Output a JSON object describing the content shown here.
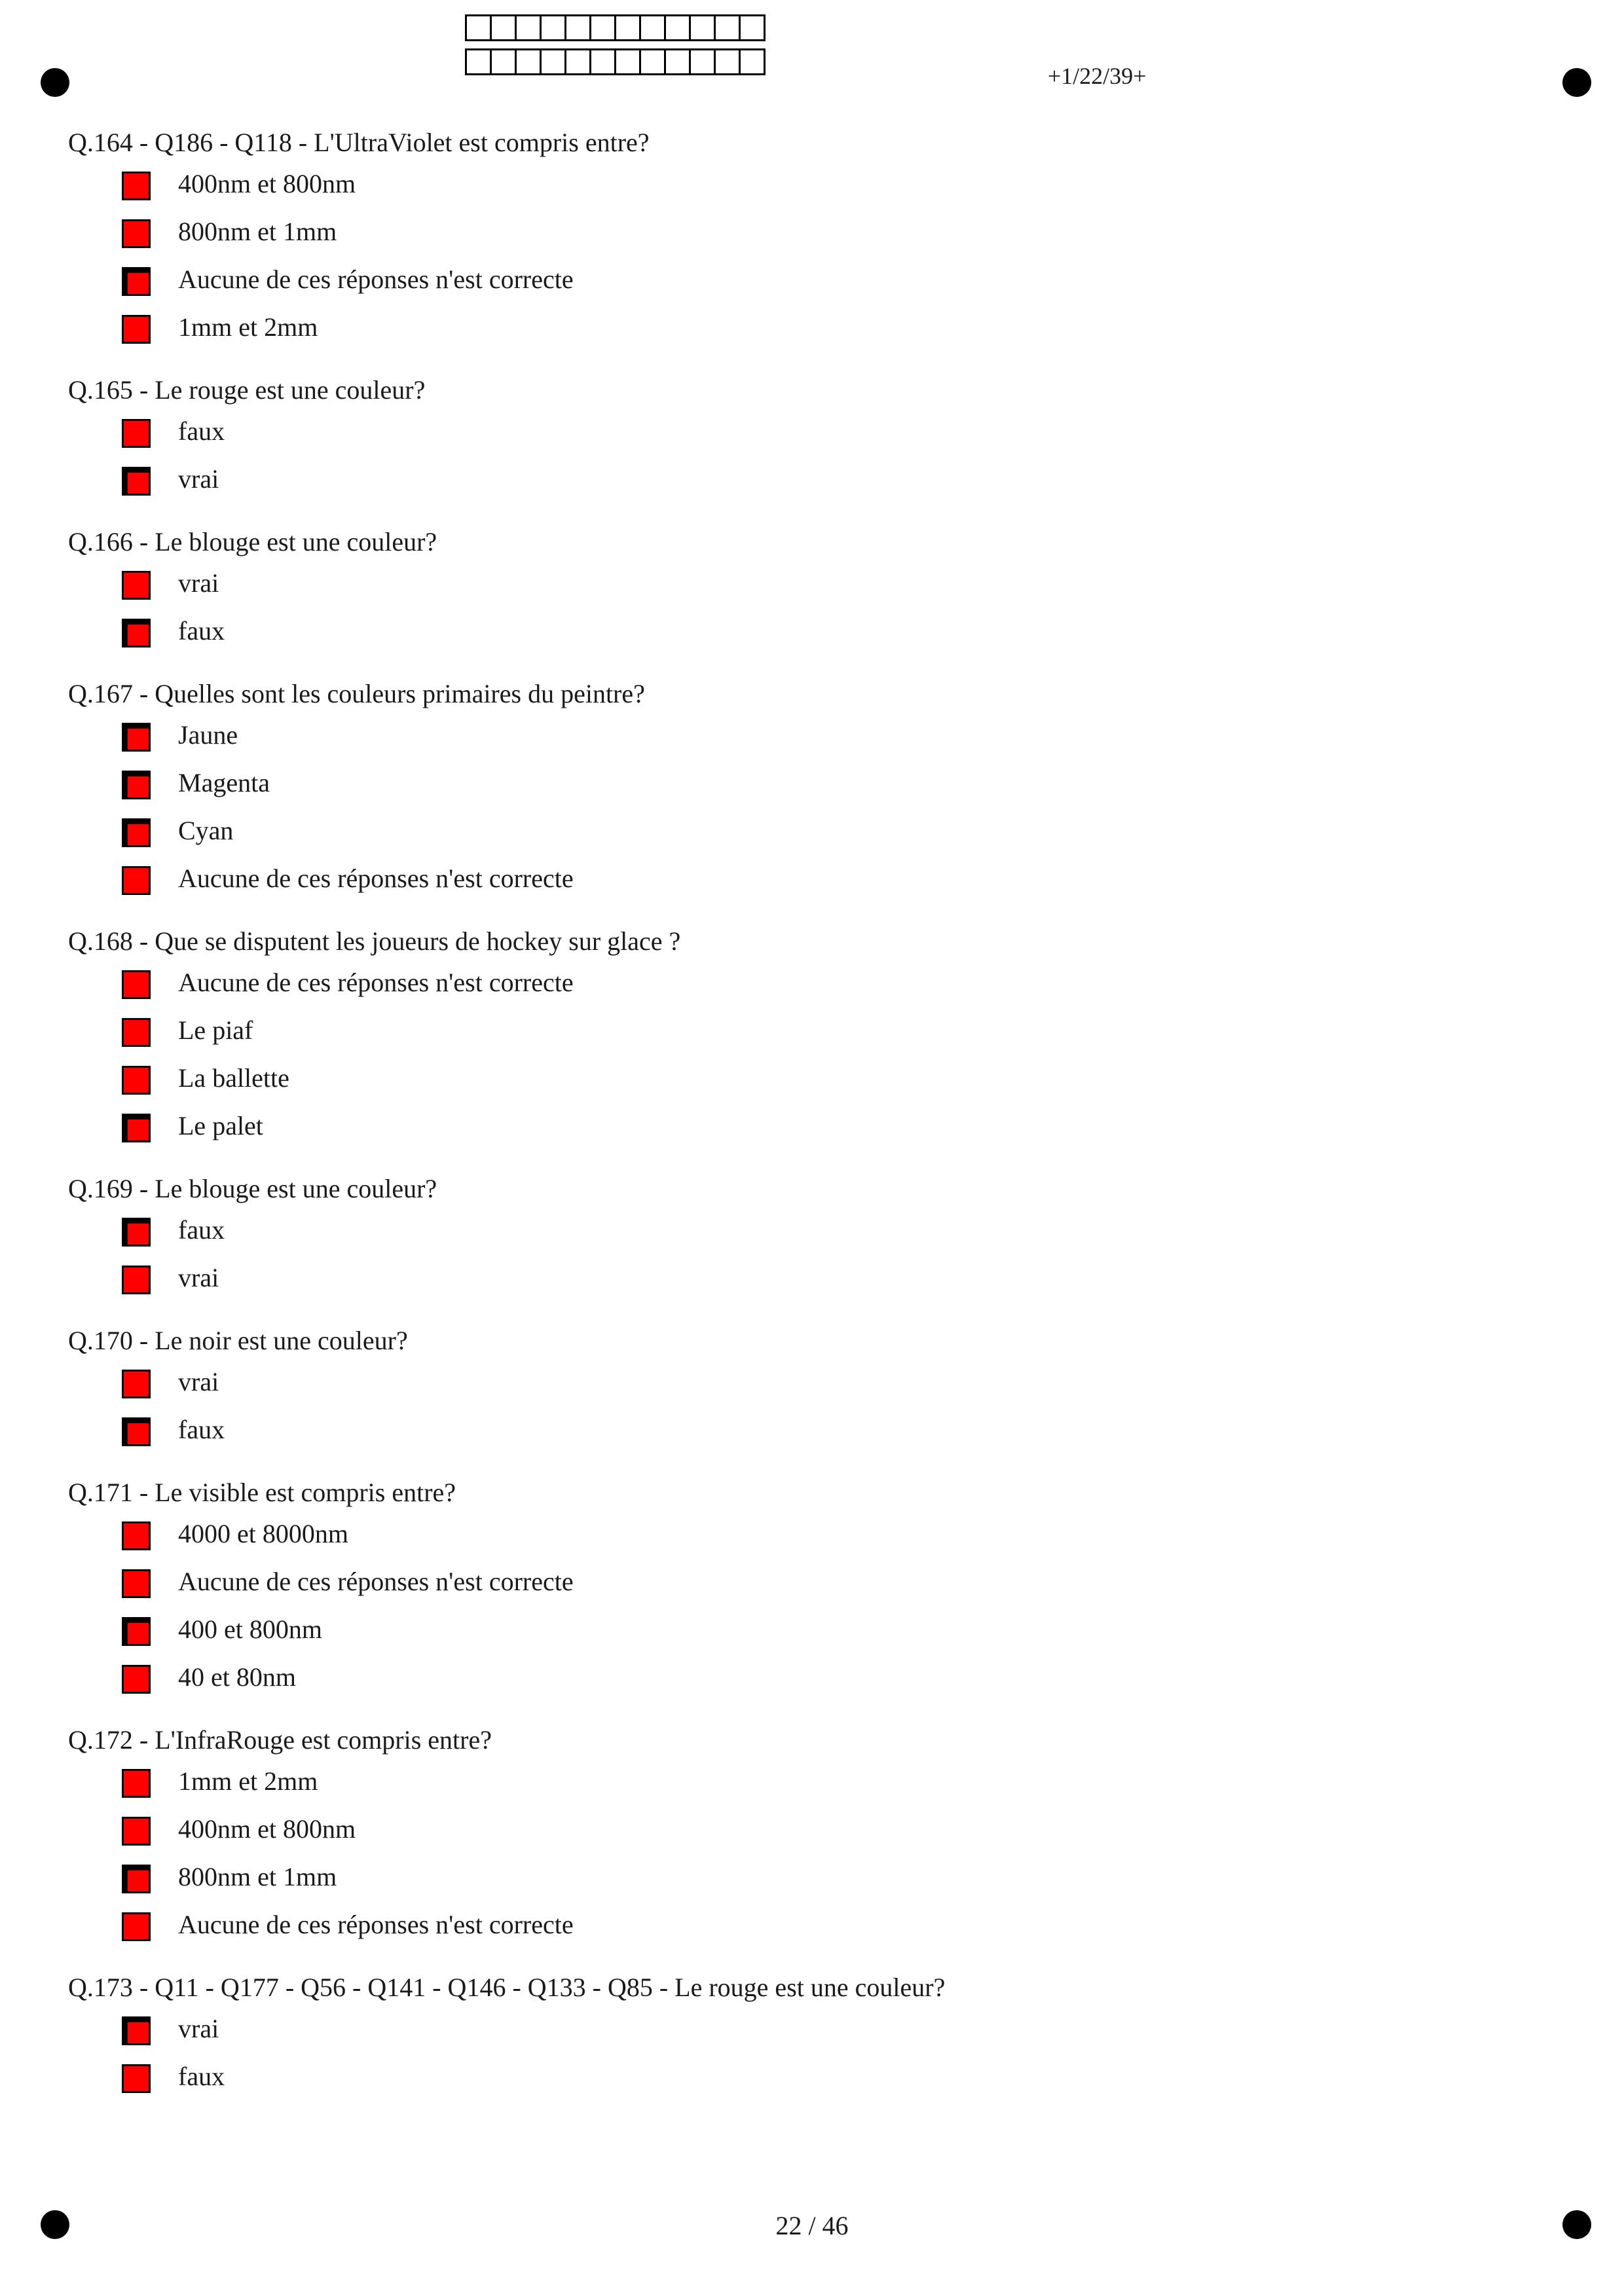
{
  "header": {
    "page_code": "+1/22/39+",
    "id_grid_cells": 12
  },
  "colors": {
    "checkbox_fill": "#ff0000",
    "checkbox_border": "#000000"
  },
  "questions": [
    {
      "title": "Q.164 - Q186 - Q118 - L'UltraViolet est compris entre?",
      "answers": [
        {
          "label": "400nm et 800nm",
          "checked": false
        },
        {
          "label": "800nm et 1mm",
          "checked": false
        },
        {
          "label": "Aucune de ces réponses n'est correcte",
          "checked": true
        },
        {
          "label": "1mm et 2mm",
          "checked": false
        }
      ]
    },
    {
      "title": "Q.165 - Le rouge est une couleur?",
      "answers": [
        {
          "label": "faux",
          "checked": false
        },
        {
          "label": "vrai",
          "checked": true
        }
      ]
    },
    {
      "title": "Q.166 - Le blouge est une couleur?",
      "answers": [
        {
          "label": "vrai",
          "checked": false
        },
        {
          "label": "faux",
          "checked": true
        }
      ]
    },
    {
      "title": "Q.167 - Quelles sont les couleurs primaires du peintre?",
      "answers": [
        {
          "label": "Jaune",
          "checked": true
        },
        {
          "label": "Magenta",
          "checked": true
        },
        {
          "label": "Cyan",
          "checked": true
        },
        {
          "label": "Aucune de ces réponses n'est correcte",
          "checked": false
        }
      ]
    },
    {
      "title": "Q.168 - Que se disputent les joueurs de hockey sur glace ?",
      "answers": [
        {
          "label": "Aucune de ces réponses n'est correcte",
          "checked": false
        },
        {
          "label": "Le piaf",
          "checked": false
        },
        {
          "label": "La ballette",
          "checked": false
        },
        {
          "label": "Le palet",
          "checked": true
        }
      ]
    },
    {
      "title": "Q.169 - Le blouge est une couleur?",
      "answers": [
        {
          "label": "faux",
          "checked": true
        },
        {
          "label": "vrai",
          "checked": false
        }
      ]
    },
    {
      "title": "Q.170 - Le noir est une couleur?",
      "answers": [
        {
          "label": "vrai",
          "checked": false
        },
        {
          "label": "faux",
          "checked": true
        }
      ]
    },
    {
      "title": "Q.171 - Le visible est compris entre?",
      "answers": [
        {
          "label": "4000 et 8000nm",
          "checked": false
        },
        {
          "label": "Aucune de ces réponses n'est correcte",
          "checked": false
        },
        {
          "label": "400 et 800nm",
          "checked": true
        },
        {
          "label": "40 et 80nm",
          "checked": false
        }
      ]
    },
    {
      "title": "Q.172 - L'InfraRouge est compris entre?",
      "answers": [
        {
          "label": "1mm et 2mm",
          "checked": false
        },
        {
          "label": "400nm et 800nm",
          "checked": false
        },
        {
          "label": "800nm et 1mm",
          "checked": true
        },
        {
          "label": "Aucune de ces réponses n'est correcte",
          "checked": false
        }
      ]
    },
    {
      "title": "Q.173 - Q11 - Q177 - Q56 - Q141 - Q146 - Q133 - Q85 - Le rouge est une couleur?",
      "answers": [
        {
          "label": "vrai",
          "checked": true
        },
        {
          "label": "faux",
          "checked": false
        }
      ]
    }
  ],
  "footer": {
    "page_number": "22 / 46"
  }
}
